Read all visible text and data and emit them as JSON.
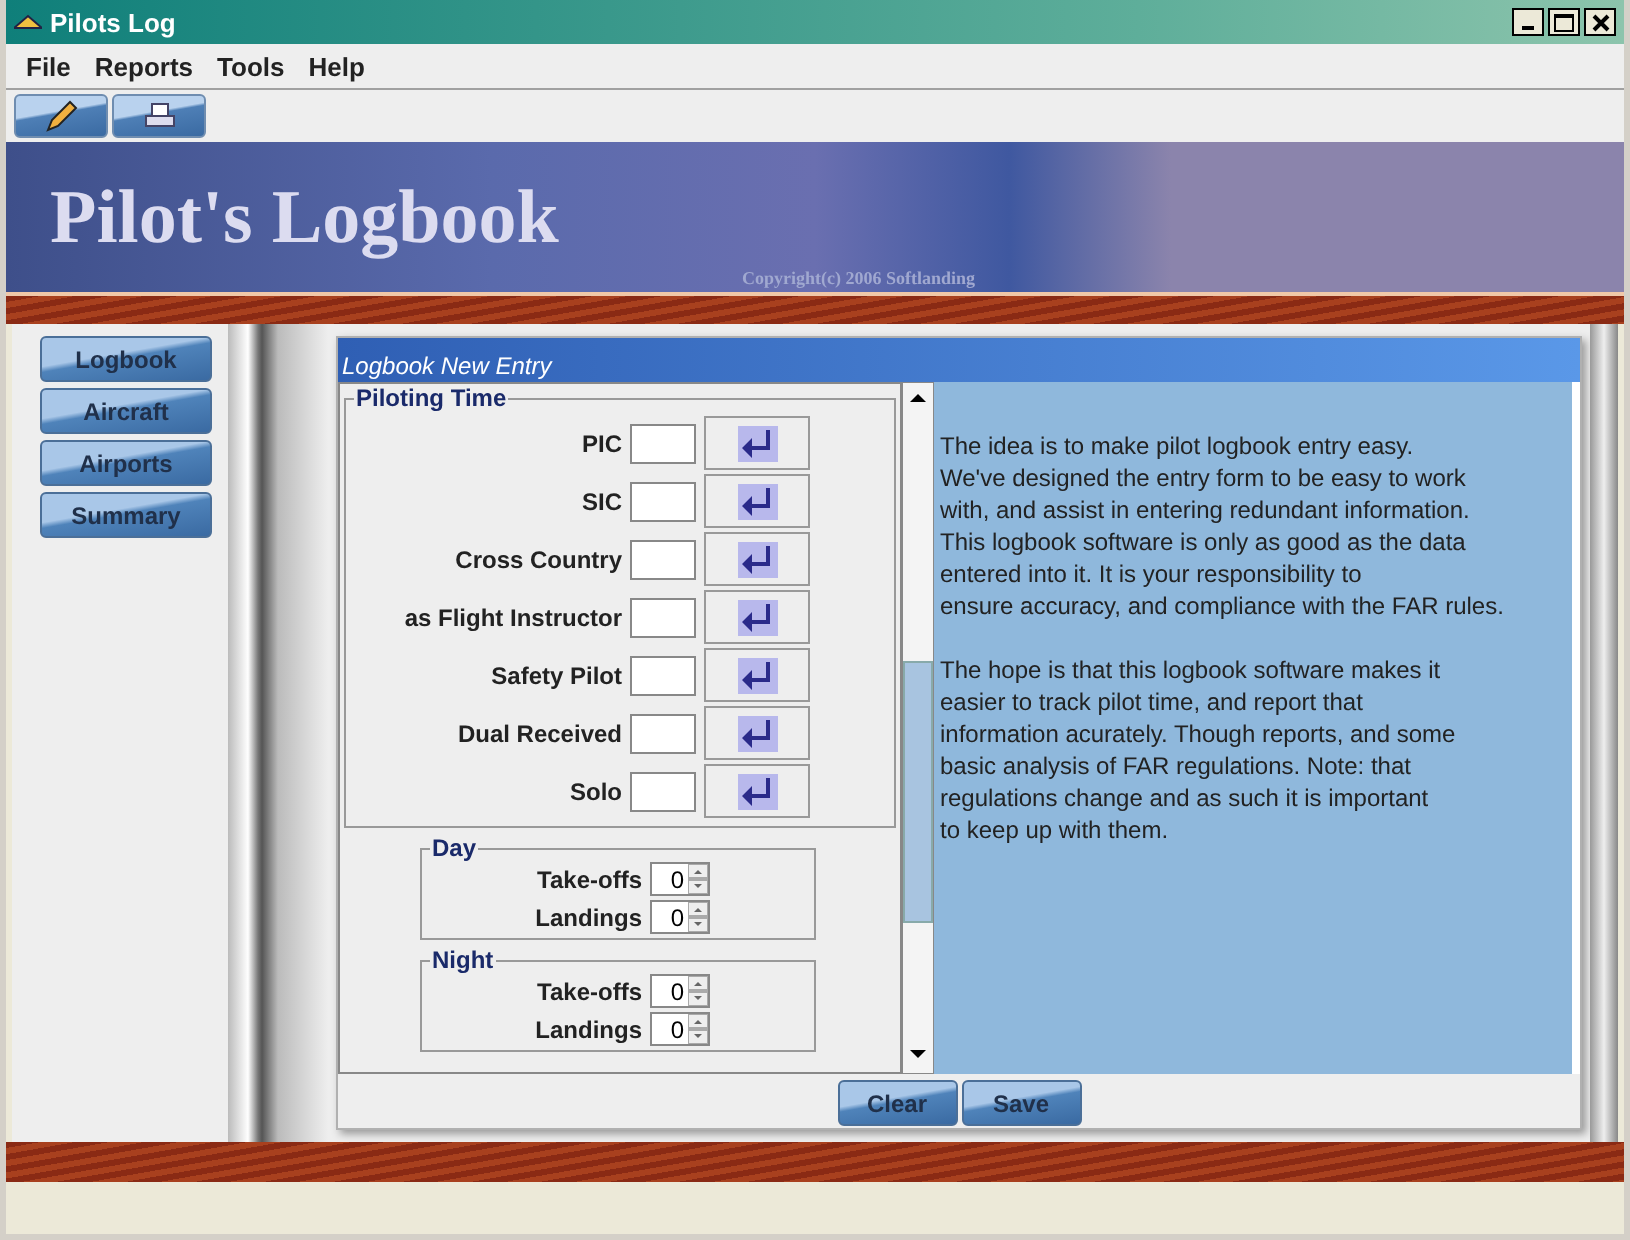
{
  "window": {
    "title": "Pilots Log"
  },
  "menu": [
    "File",
    "Reports",
    "Tools",
    "Help"
  ],
  "banner": {
    "title": "Pilot's Logbook",
    "copyright": "Copyright(c) 2006  Softlanding"
  },
  "sidebar": {
    "items": [
      {
        "label": "Logbook"
      },
      {
        "label": "Aircraft"
      },
      {
        "label": "Airports"
      },
      {
        "label": "Summary"
      }
    ]
  },
  "entry_frame": {
    "title": "Logbook New Entry",
    "piloting_time": {
      "title": "Piloting Time",
      "fields": [
        {
          "label": "PIC"
        },
        {
          "label": "SIC"
        },
        {
          "label": "Cross Country"
        },
        {
          "label": "as Flight Instructor"
        },
        {
          "label": "Safety Pilot"
        },
        {
          "label": "Dual Received"
        },
        {
          "label": "Solo"
        }
      ]
    },
    "groups": [
      {
        "title": "Day",
        "spinners": [
          {
            "label": "Take-offs",
            "value": "0"
          },
          {
            "label": "Landings",
            "value": "0"
          }
        ]
      },
      {
        "title": "Night",
        "spinners": [
          {
            "label": "Take-offs",
            "value": "0"
          },
          {
            "label": "Landings",
            "value": "0"
          }
        ]
      }
    ],
    "info": [
      [
        "The idea is to make pilot logbook entry easy.",
        "We've designed the entry form to be easy to work",
        "with, and assist in entering redundant information.",
        "This logbook software is only as good as the data",
        "entered into it. It is your responsibility to",
        "ensure accuracy, and compliance with the FAR rules."
      ],
      [
        "The hope is that this logbook software makes it",
        "easier to track pilot time, and report that",
        "information acurately. Though reports, and some",
        "basic analysis of FAR regulations. Note: that",
        "regulations change and as such it is important",
        "to keep up with them."
      ]
    ],
    "buttons": [
      "Clear",
      "Save"
    ]
  }
}
